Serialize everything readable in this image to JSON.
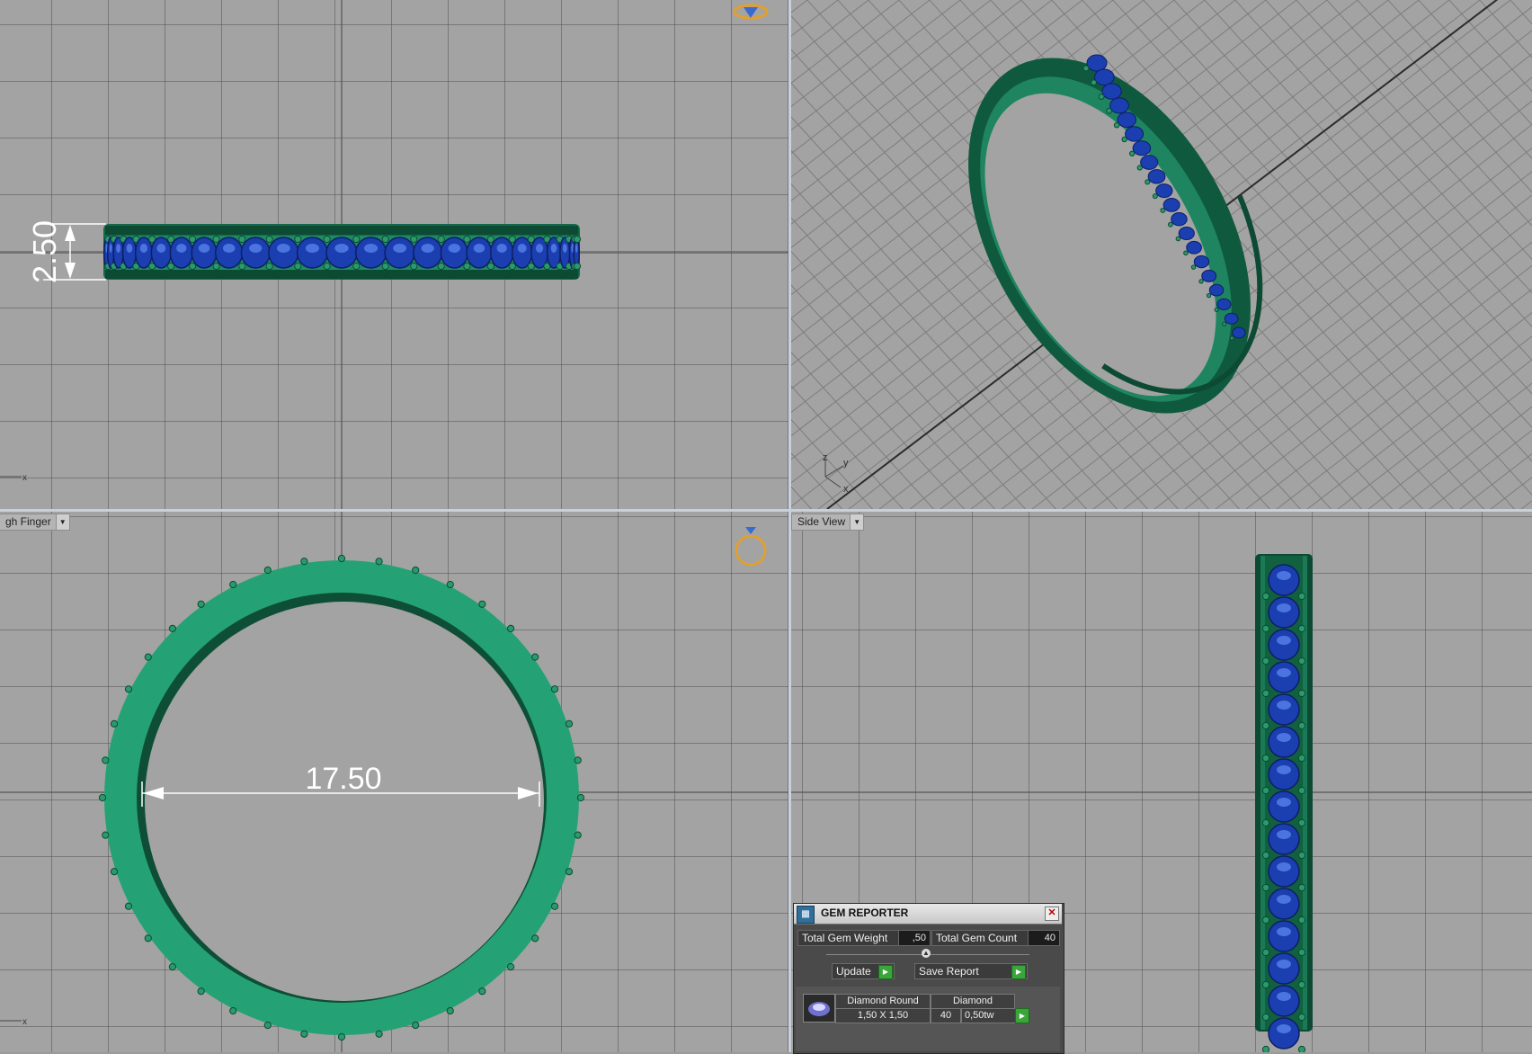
{
  "viewports": {
    "top": {
      "label": ""
    },
    "perspective": {
      "label": ""
    },
    "front": {
      "label": "gh Finger"
    },
    "side": {
      "label": "Side View"
    }
  },
  "dimensions": {
    "width": "2.50",
    "diameter": "17.50"
  },
  "axes": {
    "top": [
      "x"
    ],
    "perspective": [
      "z",
      "y",
      "x"
    ],
    "front": [
      "x"
    ]
  },
  "gem_reporter": {
    "title": "GEM REPORTER",
    "total_gem_weight_label": "Total Gem Weight",
    "total_gem_weight_value": ",50",
    "total_gem_count_label": "Total Gem Count",
    "total_gem_count_value": "40",
    "update_label": "Update",
    "save_report_label": "Save Report",
    "table": {
      "header": [
        "Diamond Round",
        "Diamond"
      ],
      "row": [
        "1,50 X 1,50",
        "40",
        "0,50tw"
      ]
    }
  },
  "colors": {
    "ring_green": "#1f8a62",
    "gem_blue": "#1b3fb0",
    "viewport_bg": "#a3a3a3",
    "annotation_white": "#ffffff",
    "gizmo_orange": "#e0a030"
  }
}
